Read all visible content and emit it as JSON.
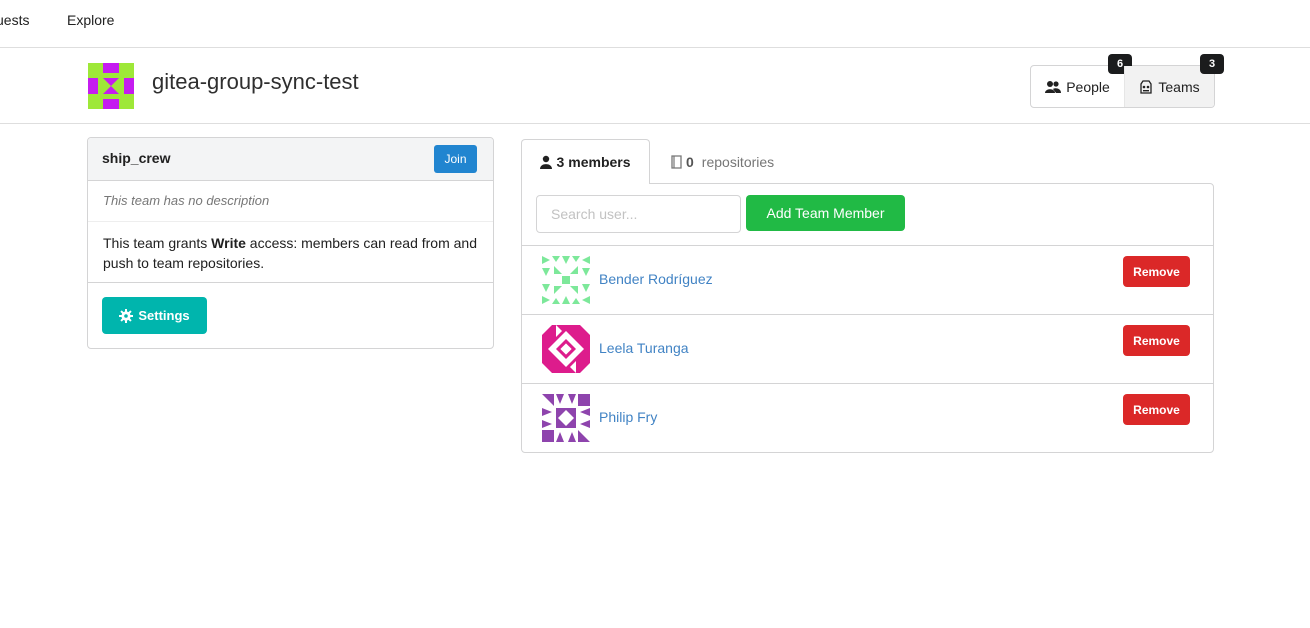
{
  "topnav": {
    "items": [
      {
        "label": "uests"
      },
      {
        "label": "Explore"
      }
    ]
  },
  "org": {
    "name": "gitea-group-sync-test",
    "menu": {
      "people": {
        "label": "People",
        "count": "6"
      },
      "teams": {
        "label": "Teams",
        "count": "3"
      }
    }
  },
  "team": {
    "name": "ship_crew",
    "join_label": "Join",
    "description": "This team has no description",
    "grant_prefix": "This team grants ",
    "grant_access": "Write",
    "grant_suffix": " access: members can read from and push to team repositories.",
    "settings_label": "Settings"
  },
  "tabs": {
    "members": {
      "count": "3",
      "label": "members"
    },
    "repositories": {
      "count": "0",
      "label": "repositories"
    }
  },
  "members_panel": {
    "search_placeholder": "Search user...",
    "add_label": "Add Team Member",
    "remove_label": "Remove",
    "members": [
      {
        "name": "Bender Rodríguez"
      },
      {
        "name": "Leela Turanga"
      },
      {
        "name": "Philip Fry"
      }
    ]
  },
  "colors": {
    "primary": "#2185d0",
    "teal": "#00b5ad",
    "green": "#21ba45",
    "red": "#db2828",
    "link": "#4183c4"
  }
}
